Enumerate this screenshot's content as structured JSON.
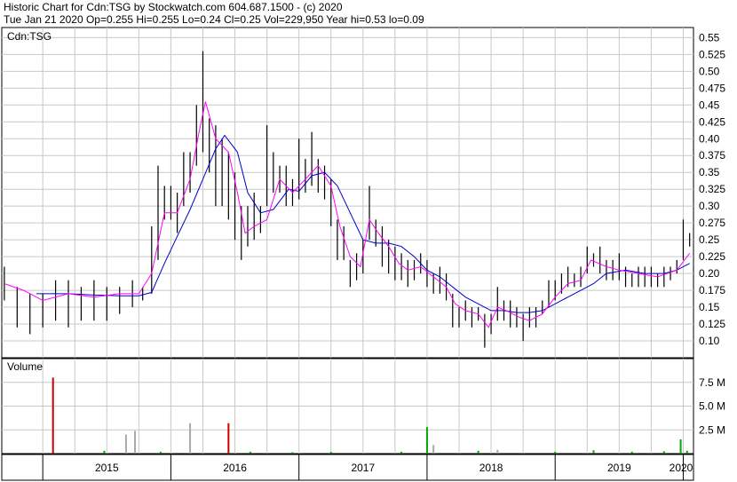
{
  "header": {
    "line1": "Historic Chart for Cdn:TSG by Stockwatch.com 604.687.1500 - (c) 2020",
    "line2": "Tue Jan 21 2020  Op=0.255  Hi=0.255  Lo=0.24  Cl=0.25  Vol=229,950  Year hi=0.53  lo=0.09"
  },
  "colors": {
    "price_bars": "#000000",
    "ma_short": "#ff00ff",
    "ma_long": "#0000cc",
    "vol_up": "#00aa00",
    "vol_down": "#cc0000",
    "vol_neutral": "#aaaaaa",
    "grid": "#c8c8c8"
  },
  "chart_data": [
    {
      "type": "line",
      "name": "price-panel",
      "legend": "Cdn:TSG",
      "ylim": [
        0.075,
        0.565
      ],
      "yticks": [
        0.55,
        0.525,
        0.5,
        0.475,
        0.45,
        0.425,
        0.4,
        0.375,
        0.35,
        0.325,
        0.3,
        0.275,
        0.25,
        0.225,
        0.2,
        0.175,
        0.15,
        0.125,
        0.1
      ],
      "ytick_labels": [
        "0.55",
        "0.525",
        "0.50",
        "0.475",
        "0.45",
        "0.425",
        "0.40",
        "0.375",
        "0.35",
        "0.325",
        "0.30",
        "0.275",
        "0.25",
        "0.225",
        "0.20",
        "0.175",
        "0.15",
        "0.125",
        "0.10"
      ],
      "xlim": [
        2014.68,
        2020.08
      ],
      "price_range_points": [
        [
          2014.7,
          0.16,
          0.21
        ],
        [
          2014.8,
          0.12,
          0.18
        ],
        [
          2014.9,
          0.11,
          0.17
        ],
        [
          2015.0,
          0.12,
          0.17
        ],
        [
          2015.1,
          0.13,
          0.19
        ],
        [
          2015.2,
          0.12,
          0.19
        ],
        [
          2015.3,
          0.13,
          0.18
        ],
        [
          2015.4,
          0.13,
          0.19
        ],
        [
          2015.5,
          0.13,
          0.18
        ],
        [
          2015.6,
          0.14,
          0.18
        ],
        [
          2015.7,
          0.15,
          0.19
        ],
        [
          2015.78,
          0.16,
          0.18
        ],
        [
          2015.85,
          0.17,
          0.27
        ],
        [
          2015.9,
          0.22,
          0.36
        ],
        [
          2015.95,
          0.28,
          0.33
        ],
        [
          2016.0,
          0.28,
          0.33
        ],
        [
          2016.05,
          0.26,
          0.32
        ],
        [
          2016.1,
          0.3,
          0.38
        ],
        [
          2016.15,
          0.32,
          0.38
        ],
        [
          2016.2,
          0.36,
          0.45
        ],
        [
          2016.25,
          0.38,
          0.53
        ],
        [
          2016.3,
          0.35,
          0.43
        ],
        [
          2016.35,
          0.3,
          0.42
        ],
        [
          2016.4,
          0.3,
          0.4
        ],
        [
          2016.45,
          0.28,
          0.38
        ],
        [
          2016.5,
          0.25,
          0.35
        ],
        [
          2016.55,
          0.22,
          0.3
        ],
        [
          2016.6,
          0.24,
          0.3
        ],
        [
          2016.65,
          0.25,
          0.32
        ],
        [
          2016.7,
          0.26,
          0.3
        ],
        [
          2016.75,
          0.3,
          0.42
        ],
        [
          2016.8,
          0.32,
          0.38
        ],
        [
          2016.85,
          0.32,
          0.36
        ],
        [
          2016.9,
          0.3,
          0.36
        ],
        [
          2016.95,
          0.3,
          0.34
        ],
        [
          2017.0,
          0.31,
          0.4
        ],
        [
          2017.05,
          0.32,
          0.37
        ],
        [
          2017.1,
          0.33,
          0.41
        ],
        [
          2017.15,
          0.32,
          0.37
        ],
        [
          2017.2,
          0.31,
          0.36
        ],
        [
          2017.25,
          0.27,
          0.34
        ],
        [
          2017.3,
          0.22,
          0.28
        ],
        [
          2017.35,
          0.22,
          0.27
        ],
        [
          2017.4,
          0.18,
          0.22
        ],
        [
          2017.45,
          0.19,
          0.23
        ],
        [
          2017.5,
          0.2,
          0.25
        ],
        [
          2017.55,
          0.25,
          0.33
        ],
        [
          2017.6,
          0.24,
          0.28
        ],
        [
          2017.65,
          0.21,
          0.27
        ],
        [
          2017.7,
          0.2,
          0.25
        ],
        [
          2017.75,
          0.19,
          0.24
        ],
        [
          2017.8,
          0.19,
          0.23
        ],
        [
          2017.85,
          0.18,
          0.22
        ],
        [
          2017.9,
          0.19,
          0.22
        ],
        [
          2017.95,
          0.2,
          0.23
        ],
        [
          2018.0,
          0.18,
          0.22
        ],
        [
          2018.05,
          0.17,
          0.2
        ],
        [
          2018.1,
          0.17,
          0.21
        ],
        [
          2018.15,
          0.16,
          0.2
        ],
        [
          2018.2,
          0.12,
          0.17
        ],
        [
          2018.25,
          0.12,
          0.15
        ],
        [
          2018.3,
          0.13,
          0.16
        ],
        [
          2018.35,
          0.12,
          0.15
        ],
        [
          2018.4,
          0.13,
          0.15
        ],
        [
          2018.45,
          0.09,
          0.14
        ],
        [
          2018.5,
          0.11,
          0.14
        ],
        [
          2018.55,
          0.13,
          0.18
        ],
        [
          2018.6,
          0.13,
          0.16
        ],
        [
          2018.65,
          0.12,
          0.16
        ],
        [
          2018.7,
          0.12,
          0.15
        ],
        [
          2018.75,
          0.1,
          0.14
        ],
        [
          2018.8,
          0.12,
          0.15
        ],
        [
          2018.85,
          0.12,
          0.15
        ],
        [
          2018.9,
          0.14,
          0.16
        ],
        [
          2018.95,
          0.15,
          0.19
        ],
        [
          2019.0,
          0.16,
          0.19
        ],
        [
          2019.05,
          0.17,
          0.2
        ],
        [
          2019.1,
          0.18,
          0.21
        ],
        [
          2019.15,
          0.18,
          0.2
        ],
        [
          2019.2,
          0.18,
          0.21
        ],
        [
          2019.25,
          0.2,
          0.24
        ],
        [
          2019.3,
          0.21,
          0.23
        ],
        [
          2019.35,
          0.2,
          0.24
        ],
        [
          2019.4,
          0.19,
          0.22
        ],
        [
          2019.45,
          0.19,
          0.22
        ],
        [
          2019.5,
          0.19,
          0.23
        ],
        [
          2019.55,
          0.18,
          0.21
        ],
        [
          2019.6,
          0.18,
          0.2
        ],
        [
          2019.65,
          0.18,
          0.21
        ],
        [
          2019.7,
          0.18,
          0.21
        ],
        [
          2019.75,
          0.18,
          0.21
        ],
        [
          2019.8,
          0.18,
          0.2
        ],
        [
          2019.85,
          0.18,
          0.21
        ],
        [
          2019.9,
          0.19,
          0.21
        ],
        [
          2019.95,
          0.2,
          0.22
        ],
        [
          2020.0,
          0.22,
          0.28
        ],
        [
          2020.05,
          0.24,
          0.26
        ]
      ],
      "ma_short_points": [
        [
          2014.7,
          0.185
        ],
        [
          2014.85,
          0.175
        ],
        [
          2015.0,
          0.16
        ],
        [
          2015.2,
          0.17
        ],
        [
          2015.4,
          0.165
        ],
        [
          2015.6,
          0.17
        ],
        [
          2015.75,
          0.17
        ],
        [
          2015.85,
          0.2
        ],
        [
          2015.95,
          0.29
        ],
        [
          2016.05,
          0.29
        ],
        [
          2016.15,
          0.34
        ],
        [
          2016.22,
          0.41
        ],
        [
          2016.27,
          0.455
        ],
        [
          2016.35,
          0.4
        ],
        [
          2016.45,
          0.38
        ],
        [
          2016.52,
          0.32
        ],
        [
          2016.58,
          0.26
        ],
        [
          2016.65,
          0.27
        ],
        [
          2016.75,
          0.28
        ],
        [
          2016.85,
          0.34
        ],
        [
          2016.95,
          0.32
        ],
        [
          2017.05,
          0.34
        ],
        [
          2017.15,
          0.36
        ],
        [
          2017.25,
          0.33
        ],
        [
          2017.32,
          0.27
        ],
        [
          2017.4,
          0.225
        ],
        [
          2017.48,
          0.21
        ],
        [
          2017.55,
          0.28
        ],
        [
          2017.62,
          0.26
        ],
        [
          2017.7,
          0.24
        ],
        [
          2017.78,
          0.215
        ],
        [
          2017.85,
          0.205
        ],
        [
          2017.95,
          0.21
        ],
        [
          2018.05,
          0.195
        ],
        [
          2018.15,
          0.18
        ],
        [
          2018.22,
          0.155
        ],
        [
          2018.3,
          0.145
        ],
        [
          2018.4,
          0.14
        ],
        [
          2018.48,
          0.12
        ],
        [
          2018.55,
          0.15
        ],
        [
          2018.62,
          0.145
        ],
        [
          2018.72,
          0.135
        ],
        [
          2018.8,
          0.13
        ],
        [
          2018.9,
          0.14
        ],
        [
          2019.0,
          0.165
        ],
        [
          2019.1,
          0.185
        ],
        [
          2019.2,
          0.19
        ],
        [
          2019.28,
          0.22
        ],
        [
          2019.4,
          0.21
        ],
        [
          2019.5,
          0.205
        ],
        [
          2019.65,
          0.2
        ],
        [
          2019.8,
          0.195
        ],
        [
          2019.95,
          0.205
        ],
        [
          2020.05,
          0.23
        ]
      ],
      "ma_long_points": [
        [
          2014.95,
          0.17
        ],
        [
          2015.2,
          0.17
        ],
        [
          2015.4,
          0.168
        ],
        [
          2015.6,
          0.167
        ],
        [
          2015.75,
          0.167
        ],
        [
          2015.85,
          0.172
        ],
        [
          2015.95,
          0.215
        ],
        [
          2016.05,
          0.255
        ],
        [
          2016.15,
          0.295
        ],
        [
          2016.25,
          0.34
        ],
        [
          2016.35,
          0.385
        ],
        [
          2016.42,
          0.405
        ],
        [
          2016.52,
          0.38
        ],
        [
          2016.6,
          0.32
        ],
        [
          2016.7,
          0.29
        ],
        [
          2016.8,
          0.295
        ],
        [
          2016.92,
          0.325
        ],
        [
          2017.0,
          0.322
        ],
        [
          2017.1,
          0.345
        ],
        [
          2017.2,
          0.35
        ],
        [
          2017.3,
          0.33
        ],
        [
          2017.4,
          0.29
        ],
        [
          2017.5,
          0.25
        ],
        [
          2017.6,
          0.245
        ],
        [
          2017.7,
          0.245
        ],
        [
          2017.8,
          0.24
        ],
        [
          2017.9,
          0.225
        ],
        [
          2018.0,
          0.205
        ],
        [
          2018.1,
          0.195
        ],
        [
          2018.2,
          0.18
        ],
        [
          2018.3,
          0.165
        ],
        [
          2018.4,
          0.155
        ],
        [
          2018.5,
          0.145
        ],
        [
          2018.6,
          0.145
        ],
        [
          2018.7,
          0.142
        ],
        [
          2018.8,
          0.142
        ],
        [
          2018.9,
          0.145
        ],
        [
          2019.0,
          0.155
        ],
        [
          2019.1,
          0.165
        ],
        [
          2019.2,
          0.175
        ],
        [
          2019.3,
          0.185
        ],
        [
          2019.4,
          0.2
        ],
        [
          2019.55,
          0.205
        ],
        [
          2019.7,
          0.2
        ],
        [
          2019.85,
          0.2
        ],
        [
          2019.95,
          0.205
        ],
        [
          2020.05,
          0.215
        ]
      ]
    },
    {
      "type": "bar",
      "name": "volume-panel",
      "title": "Volume",
      "ylim": [
        0,
        10000000
      ],
      "yticks": [
        7500000,
        5000000,
        2500000
      ],
      "ytick_labels": [
        "7.5 M",
        "5.0 M",
        "2.5 M"
      ],
      "bars": [
        [
          2015.08,
          8000000,
          "down"
        ],
        [
          2015.48,
          300000,
          "up"
        ],
        [
          2015.65,
          2000000,
          "neutral"
        ],
        [
          2015.72,
          2400000,
          "neutral"
        ],
        [
          2015.92,
          200000,
          "up"
        ],
        [
          2016.15,
          3200000,
          "neutral"
        ],
        [
          2016.45,
          3200000,
          "down"
        ],
        [
          2016.62,
          200000,
          "up"
        ],
        [
          2016.95,
          150000,
          "up"
        ],
        [
          2017.25,
          180000,
          "up"
        ],
        [
          2017.8,
          200000,
          "up"
        ],
        [
          2018.0,
          2800000,
          "up"
        ],
        [
          2018.05,
          900000,
          "neutral"
        ],
        [
          2018.4,
          300000,
          "up"
        ],
        [
          2018.55,
          400000,
          "neutral"
        ],
        [
          2019.0,
          200000,
          "up"
        ],
        [
          2019.3,
          350000,
          "up"
        ],
        [
          2019.6,
          200000,
          "up"
        ],
        [
          2019.85,
          250000,
          "up"
        ],
        [
          2019.98,
          1500000,
          "up"
        ],
        [
          2020.03,
          300000,
          "up"
        ]
      ]
    },
    {
      "type": "axis",
      "name": "year-axis",
      "labels": [
        [
          2015.0,
          "2015"
        ],
        [
          2016.0,
          "2016"
        ],
        [
          2017.0,
          "2017"
        ],
        [
          2018.0,
          "2018"
        ],
        [
          2019.0,
          "2019"
        ],
        [
          2020.0,
          "2020"
        ]
      ]
    }
  ]
}
